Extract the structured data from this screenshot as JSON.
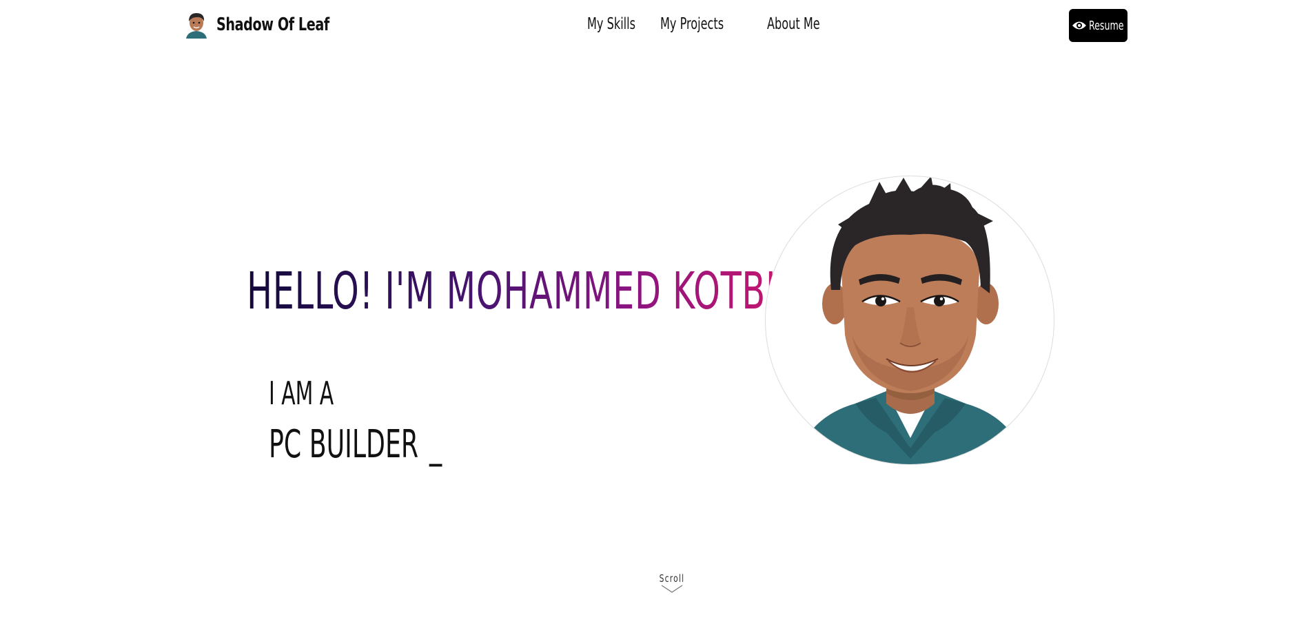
{
  "header": {
    "brand_name": "Shadow Of Leaf",
    "brand_icon": "avatar-icon",
    "nav": [
      {
        "label": "My Skills"
      },
      {
        "label": "My Projects"
      },
      {
        "label": "About Me"
      }
    ],
    "resume_button": {
      "label": "Resume",
      "icon": "eye-icon"
    }
  },
  "hero": {
    "greeting_prefix": "HELLO!",
    "greeting_name": "I'M MOHAMMED KOTBI",
    "intro": "I AM A",
    "role": "PC BUILDER",
    "cursor": "_",
    "portrait_icon": "avatar-portrait"
  },
  "scroll": {
    "label": "Scroll",
    "icon": "chevron-down-icon"
  },
  "colors": {
    "gradient_start": "#140a3a",
    "gradient_mid": "#4a1470",
    "gradient_end": "#c21670",
    "resume_bg": "#000000",
    "shirt": "#2e6e78",
    "skin": "#b97a56",
    "hair": "#2a2628"
  }
}
